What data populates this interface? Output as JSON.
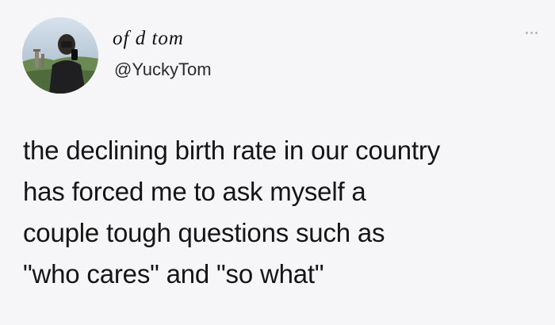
{
  "author": {
    "display_name": "of d tom",
    "handle": "@YuckyTom"
  },
  "tweet": {
    "lines": [
      "the declining birth rate in our country",
      "has forced me to ask myself a",
      "couple tough questions such as",
      "\"who cares\" and \"so what\""
    ]
  },
  "icons": {
    "menu": "more-options-icon"
  },
  "colors": {
    "background": "#f6f6f8",
    "text": "#151515",
    "muted": "#b5b5b5"
  }
}
